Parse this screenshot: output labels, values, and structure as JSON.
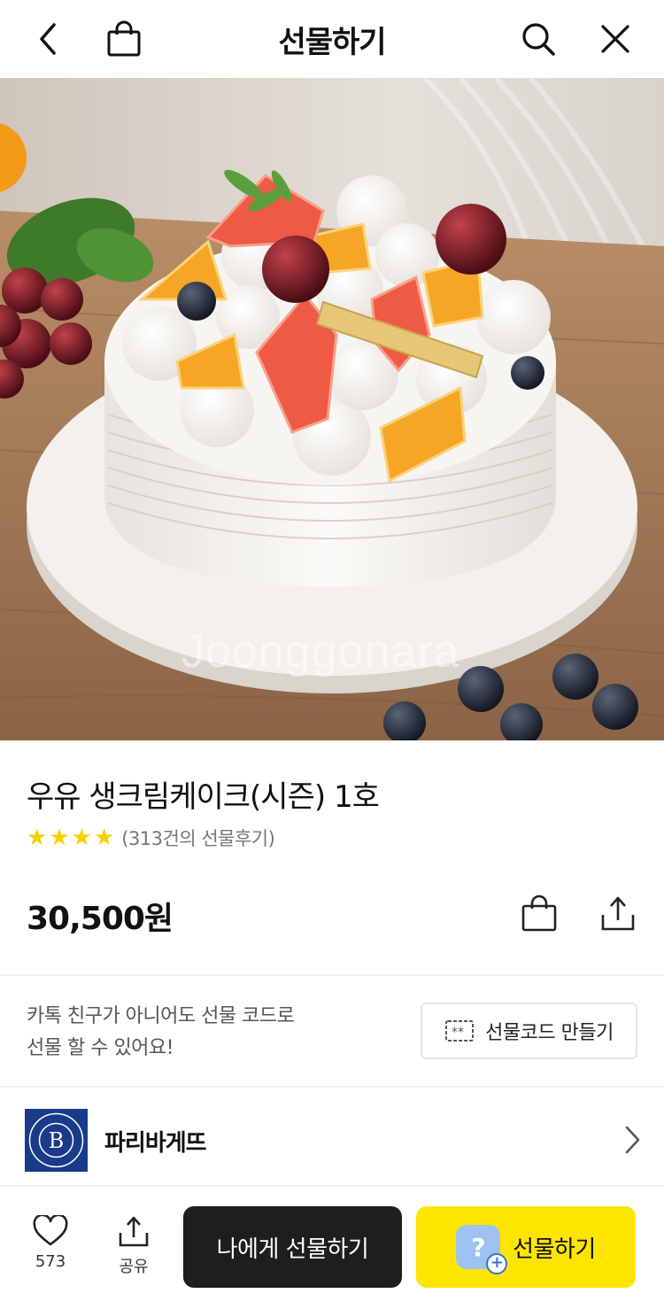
{
  "header": {
    "title": "선물하기",
    "back_icon": "chevron-left-icon",
    "cart_icon": "shopping-bag-icon",
    "search_icon": "search-icon",
    "close_icon": "close-icon"
  },
  "hero": {
    "watermark": "Joonggonara"
  },
  "product": {
    "title": "우유 생크림케이크(시즌) 1호",
    "rating_stars": 4,
    "review_text": "(313건의 선물후기)",
    "price": "30,500원"
  },
  "gift_code": {
    "line1": "카톡 친구가 아니어도 선물 코드로",
    "line2": "선물 할 수 있어요!",
    "button_label": "선물코드 만들기"
  },
  "brand": {
    "name": "파리바게뜨",
    "logo_letter": "B"
  },
  "bottom_bar": {
    "like_count": "573",
    "share_label": "공유",
    "self_gift_label": "나에게 선물하기",
    "gift_label": "선물하기",
    "gift_icon_glyph": "?",
    "gift_icon_plus": "+"
  },
  "colors": {
    "accent_yellow": "#fee500",
    "star_yellow": "#f5d000",
    "dark_button": "#1e1e1e",
    "brand_blue": "#1a3a8a"
  }
}
